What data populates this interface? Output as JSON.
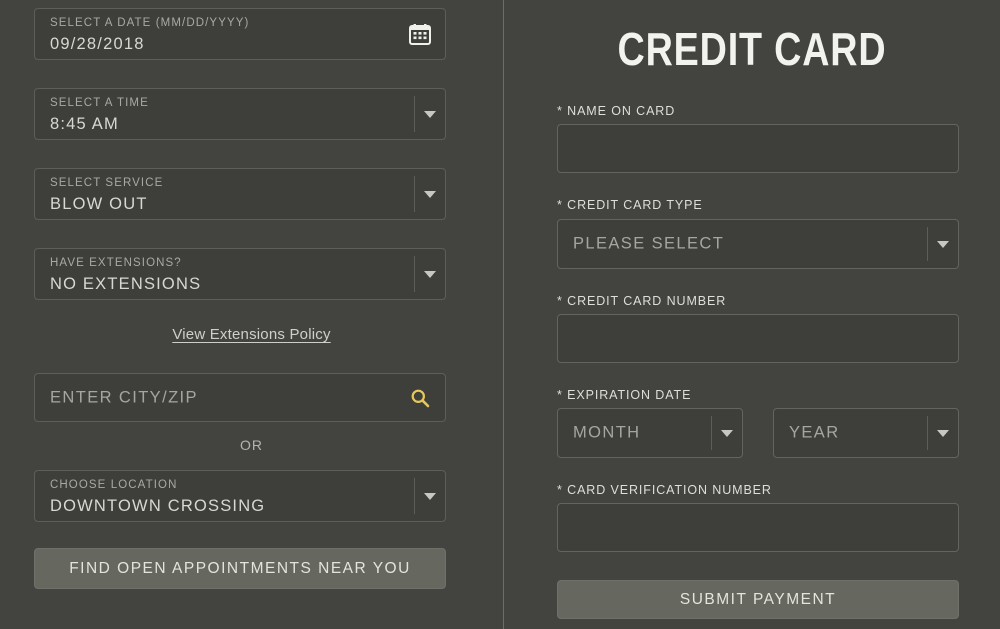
{
  "colors": {
    "background": "#434440",
    "field_fill": "#3e3f3b",
    "field_border": "#5d5e59",
    "button_fill": "#66675f",
    "accent_search": "#e8c75a",
    "text_primary": "#d8d8d2",
    "text_label": "#a9a9a3",
    "divider": "#6d6e69"
  },
  "booking": {
    "date": {
      "label": "SELECT A DATE (MM/DD/YYYY)",
      "value": "09/28/2018",
      "icon": "calendar-icon"
    },
    "time": {
      "label": "SELECT A TIME",
      "value": "8:45 AM",
      "icon": "chevron-down-icon"
    },
    "service": {
      "label": "SELECT SERVICE",
      "value": "BLOW OUT",
      "icon": "chevron-down-icon"
    },
    "extensions": {
      "label": "HAVE EXTENSIONS?",
      "value": "NO EXTENSIONS",
      "icon": "chevron-down-icon"
    },
    "policy_link": "View Extensions Policy",
    "city_zip": {
      "placeholder": "ENTER CITY/ZIP",
      "value": "",
      "icon": "search-icon"
    },
    "or_divider": "OR",
    "location": {
      "label": "CHOOSE LOCATION",
      "value": "DOWNTOWN CROSSING",
      "icon": "chevron-down-icon"
    },
    "find_button": "FIND OPEN APPOINTMENTS NEAR YOU"
  },
  "credit_card": {
    "title": "CREDIT CARD",
    "name_on_card": {
      "label": "* NAME ON CARD",
      "value": ""
    },
    "card_type": {
      "label": "* CREDIT CARD TYPE",
      "placeholder": "PLEASE SELECT",
      "value": "",
      "icon": "chevron-down-icon"
    },
    "card_number": {
      "label": "* CREDIT CARD NUMBER",
      "value": ""
    },
    "expiration": {
      "label": "* EXPIRATION DATE",
      "month": {
        "placeholder": "MONTH",
        "value": "",
        "icon": "chevron-down-icon"
      },
      "year": {
        "placeholder": "YEAR",
        "value": "",
        "icon": "chevron-down-icon"
      }
    },
    "cvn": {
      "label": "* CARD VERIFICATION NUMBER",
      "value": ""
    },
    "submit_button": "SUBMIT PAYMENT"
  }
}
